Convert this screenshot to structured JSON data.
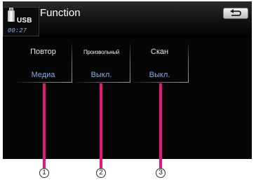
{
  "header": {
    "title": "Function",
    "source_label": "USB",
    "elapsed_time": "00:27",
    "back_icon": "return-arrow-icon"
  },
  "functions": [
    {
      "label": "Повтор",
      "value": "Медиа"
    },
    {
      "label": "Произвольный",
      "value": "Выкл."
    },
    {
      "label": "Скан",
      "value": "Выкл."
    }
  ],
  "callouts": [
    "1",
    "2",
    "3"
  ],
  "colors": {
    "accent_value": "#7fb0e6",
    "callout_line": "#e7167c",
    "screen_background": "#050505"
  }
}
